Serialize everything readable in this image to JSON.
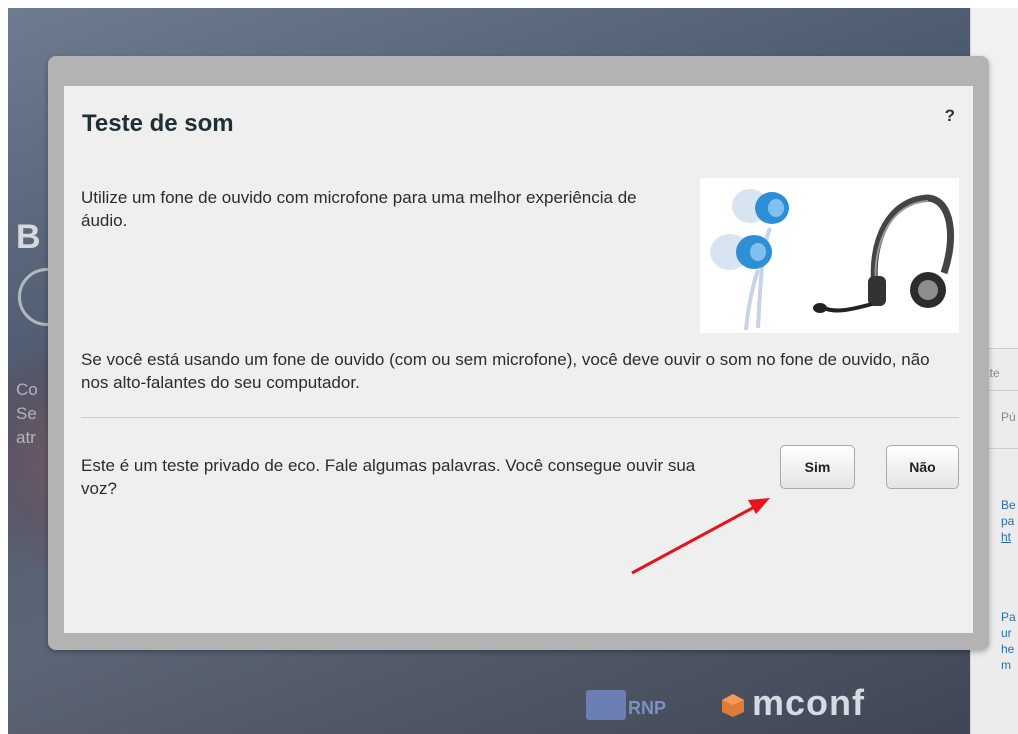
{
  "dialog": {
    "title": "Teste de som",
    "help_label": "?",
    "intro_text": "Utilize um fone de ouvido com microfone para uma melhor experiência de áudio.",
    "info_text": "Se você está usando um fone de ouvido (com ou sem microfone), você deve ouvir o som no fone de ouvido, não nos alto-falantes do seu computador.",
    "question_text": "Este é um teste privado de eco. Fale algumas palavras. Você consegue ouvir sua voz?",
    "buttons": {
      "yes_label": "Sim",
      "no_label": "Não"
    }
  },
  "background": {
    "letters": [
      "B"
    ],
    "text_fragments": [
      "Co",
      "Se",
      "atr"
    ]
  },
  "right_panel": {
    "header_fragment": "Bate",
    "tab_fragment": "Pú",
    "message_fragments": [
      "Be",
      "pa",
      "ht",
      "Pa",
      "ur",
      "he",
      "m"
    ]
  },
  "footer_logos": {
    "rnp": "RNP",
    "mconf": "mconf"
  },
  "colors": {
    "annotation_arrow": "#e8121b",
    "headset_blue": "#2e8fd6"
  }
}
